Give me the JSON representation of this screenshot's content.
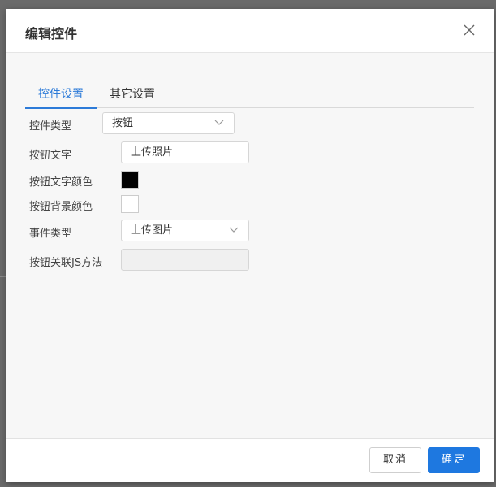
{
  "dialog": {
    "title": "编辑控件"
  },
  "tabs": [
    {
      "label": "控件设置",
      "active": true
    },
    {
      "label": "其它设置",
      "active": false
    }
  ],
  "form": {
    "control_type": {
      "label": "控件类型",
      "value": "按钮"
    },
    "button_text": {
      "label": "按钮文字",
      "value": "上传照片"
    },
    "text_color": {
      "label": "按钮文字颜色",
      "color": "#000000"
    },
    "bg_color": {
      "label": "按钮背景颜色",
      "color": "#ffffff"
    },
    "event_type": {
      "label": "事件类型",
      "value": "上传图片"
    },
    "js_method": {
      "label": "按钮关联JS方法",
      "value": ""
    }
  },
  "footer": {
    "cancel_label": "取消",
    "ok_label": "确定"
  },
  "colors": {
    "accent": "#2d7bd8",
    "primary_button": "#1e78e0"
  },
  "icons": {
    "close": "close-icon",
    "dropdown": "chevron-down-icon"
  }
}
